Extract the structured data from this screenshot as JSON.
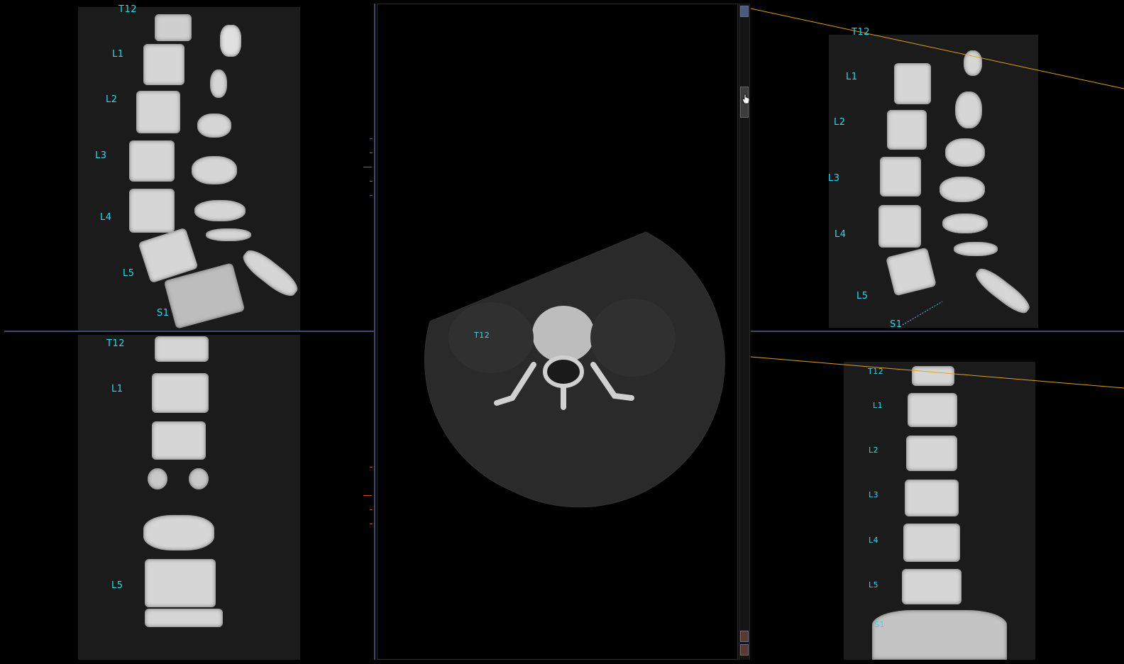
{
  "viewer": {
    "colors": {
      "label": "#2fd6ee",
      "divider": "#3c4a6e",
      "reference_line": "#e0a020",
      "tick": "#c8501e"
    }
  },
  "panes": {
    "top_left": {
      "view": "sagittal",
      "labels": [
        "T12",
        "L1",
        "L2",
        "L3",
        "L4",
        "L5",
        "S1"
      ]
    },
    "bottom_left": {
      "view": "coronal",
      "labels": [
        "T12",
        "L1",
        "L5"
      ]
    },
    "center": {
      "view": "axial",
      "labels": [
        "T12"
      ]
    },
    "top_right": {
      "view": "sagittal",
      "labels": [
        "T12",
        "L1",
        "L2",
        "L3",
        "L4",
        "L5",
        "S1"
      ]
    },
    "bottom_right": {
      "view": "coronal",
      "labels": [
        "T12",
        "L1",
        "L2",
        "L3",
        "L4",
        "L5",
        "S1"
      ]
    }
  },
  "scrollbar": {
    "icons": [
      "scroll-up-down-icon",
      "hand-cursor-icon",
      "layout-icon",
      "layout-alt-icon"
    ]
  }
}
